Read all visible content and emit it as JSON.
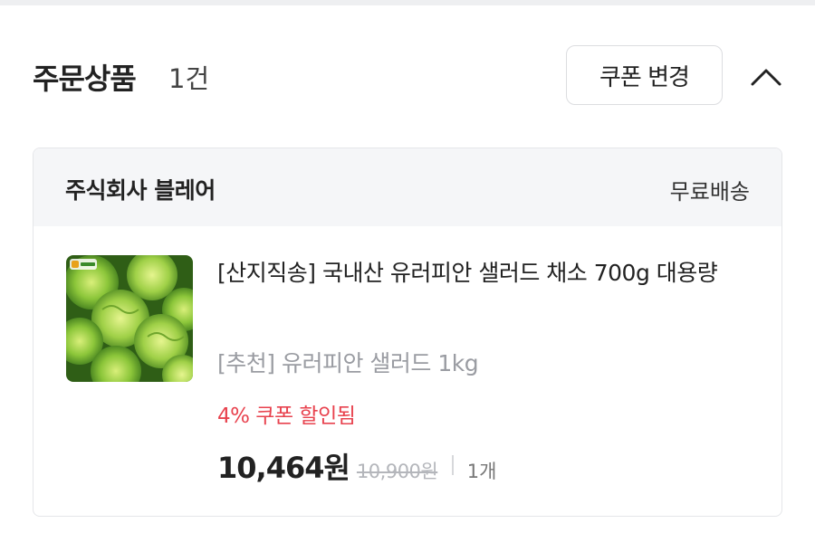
{
  "order": {
    "title": "주문상품",
    "count": "1건",
    "coupon_button": "쿠폰 변경",
    "collapse_icon": "chevron-up-icon"
  },
  "seller": {
    "name": "주식회사 블레어",
    "shipping": "무료배송"
  },
  "product": {
    "thumbnail": "lettuce-product-image",
    "title": "[산지직송] 국내산 유러피안 샐러드 채소 700g 대용량",
    "option": "[추천] 유러피안 샐러드 1kg",
    "discount": "4% 쿠폰 할인됨",
    "price": "10,464원",
    "original_price": "10,900원",
    "quantity": "1개"
  },
  "colors": {
    "discount_red": "#e8424e",
    "header_bg": "#f5f6f8"
  }
}
